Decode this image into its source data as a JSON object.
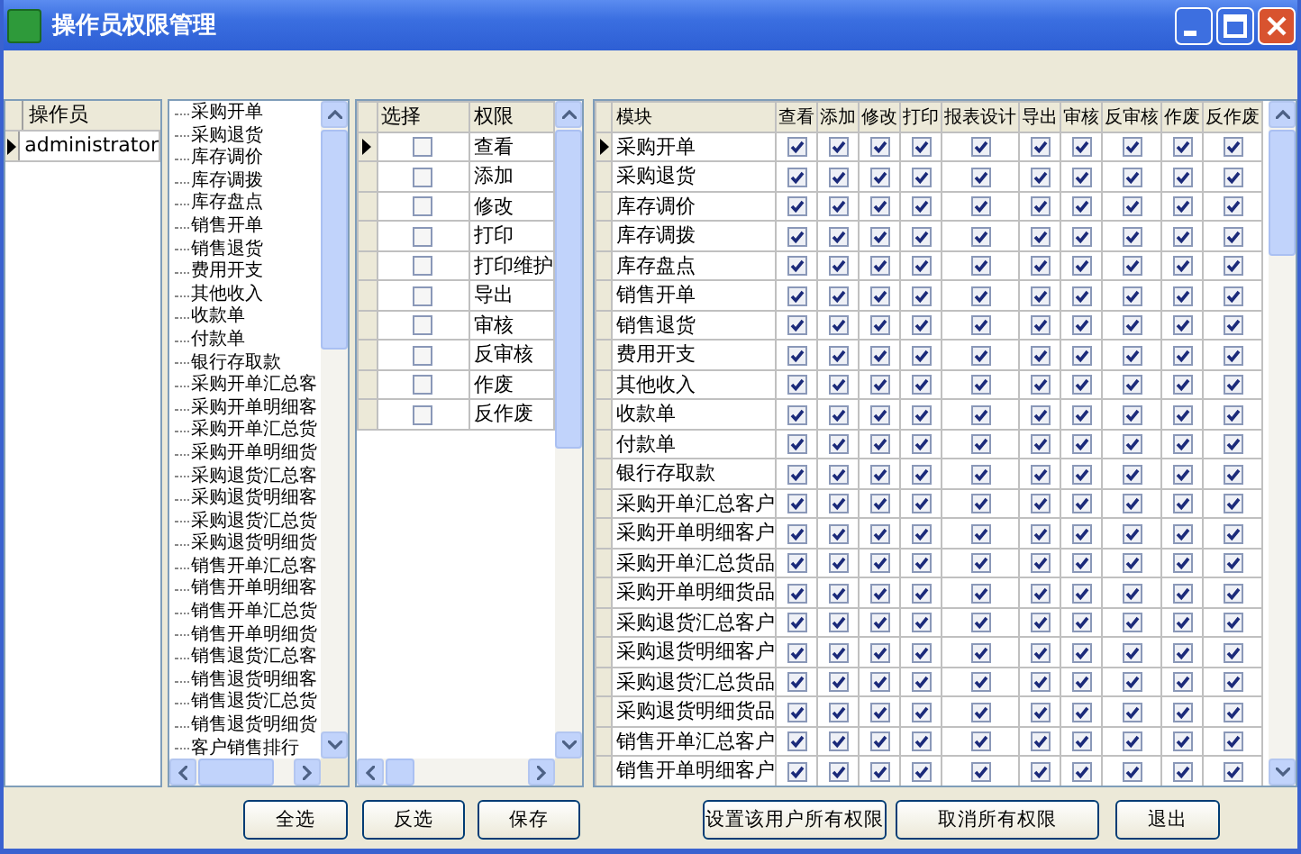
{
  "window": {
    "title": "操作员权限管理"
  },
  "operators": {
    "header": "操作员",
    "rows": [
      {
        "name": "administrator",
        "selected": true
      }
    ]
  },
  "modules_tree": {
    "items": [
      "采购开单",
      "采购退货",
      "库存调价",
      "库存调拨",
      "库存盘点",
      "销售开单",
      "销售退货",
      "费用开支",
      "其他收入",
      "收款单",
      "付款单",
      "银行存取款",
      "采购开单汇总客",
      "采购开单明细客",
      "采购开单汇总货",
      "采购开单明细货",
      "采购退货汇总客",
      "采购退货明细客",
      "采购退货汇总货",
      "采购退货明细货",
      "销售开单汇总客",
      "销售开单明细客",
      "销售开单汇总货",
      "销售开单明细货",
      "销售退货汇总客",
      "销售退货明细客",
      "销售退货汇总货",
      "销售退货明细货",
      "客户销售排行"
    ]
  },
  "rights_grid": {
    "columns": [
      "选择",
      "权限"
    ],
    "rows": [
      {
        "checked": false,
        "name": "查看",
        "selected": true
      },
      {
        "checked": false,
        "name": "添加",
        "selected": false
      },
      {
        "checked": false,
        "name": "修改",
        "selected": false
      },
      {
        "checked": false,
        "name": "打印",
        "selected": false
      },
      {
        "checked": false,
        "name": "打印维护",
        "selected": false
      },
      {
        "checked": false,
        "name": "导出",
        "selected": false
      },
      {
        "checked": false,
        "name": "审核",
        "selected": false
      },
      {
        "checked": false,
        "name": "反审核",
        "selected": false
      },
      {
        "checked": false,
        "name": "作废",
        "selected": false
      },
      {
        "checked": false,
        "name": "反作废",
        "selected": false
      }
    ]
  },
  "permissions_grid": {
    "columns": [
      "模块",
      "查看",
      "添加",
      "修改",
      "打印",
      "报表设计",
      "导出",
      "审核",
      "反审核",
      "作废",
      "反作废"
    ],
    "rows": [
      {
        "module": "采购开单",
        "selected": true,
        "checks": [
          true,
          true,
          true,
          true,
          true,
          true,
          true,
          true,
          true,
          true
        ]
      },
      {
        "module": "采购退货",
        "selected": false,
        "checks": [
          true,
          true,
          true,
          true,
          true,
          true,
          true,
          true,
          true,
          true
        ]
      },
      {
        "module": "库存调价",
        "selected": false,
        "checks": [
          true,
          true,
          true,
          true,
          true,
          true,
          true,
          true,
          true,
          true
        ]
      },
      {
        "module": "库存调拨",
        "selected": false,
        "checks": [
          true,
          true,
          true,
          true,
          true,
          true,
          true,
          true,
          true,
          true
        ]
      },
      {
        "module": "库存盘点",
        "selected": false,
        "checks": [
          true,
          true,
          true,
          true,
          true,
          true,
          true,
          true,
          true,
          true
        ]
      },
      {
        "module": "销售开单",
        "selected": false,
        "checks": [
          true,
          true,
          true,
          true,
          true,
          true,
          true,
          true,
          true,
          true
        ]
      },
      {
        "module": "销售退货",
        "selected": false,
        "checks": [
          true,
          true,
          true,
          true,
          true,
          true,
          true,
          true,
          true,
          true
        ]
      },
      {
        "module": "费用开支",
        "selected": false,
        "checks": [
          true,
          true,
          true,
          true,
          true,
          true,
          true,
          true,
          true,
          true
        ]
      },
      {
        "module": "其他收入",
        "selected": false,
        "checks": [
          true,
          true,
          true,
          true,
          true,
          true,
          true,
          true,
          true,
          true
        ]
      },
      {
        "module": "收款单",
        "selected": false,
        "checks": [
          true,
          true,
          true,
          true,
          true,
          true,
          true,
          true,
          true,
          true
        ]
      },
      {
        "module": "付款单",
        "selected": false,
        "checks": [
          true,
          true,
          true,
          true,
          true,
          true,
          true,
          true,
          true,
          true
        ]
      },
      {
        "module": "银行存取款",
        "selected": false,
        "checks": [
          true,
          true,
          true,
          true,
          true,
          true,
          true,
          true,
          true,
          true
        ]
      },
      {
        "module": "采购开单汇总客户",
        "selected": false,
        "checks": [
          true,
          true,
          true,
          true,
          true,
          true,
          true,
          true,
          true,
          true
        ]
      },
      {
        "module": "采购开单明细客户",
        "selected": false,
        "checks": [
          true,
          true,
          true,
          true,
          true,
          true,
          true,
          true,
          true,
          true
        ]
      },
      {
        "module": "采购开单汇总货品",
        "selected": false,
        "checks": [
          true,
          true,
          true,
          true,
          true,
          true,
          true,
          true,
          true,
          true
        ]
      },
      {
        "module": "采购开单明细货品",
        "selected": false,
        "checks": [
          true,
          true,
          true,
          true,
          true,
          true,
          true,
          true,
          true,
          true
        ]
      },
      {
        "module": "采购退货汇总客户",
        "selected": false,
        "checks": [
          true,
          true,
          true,
          true,
          true,
          true,
          true,
          true,
          true,
          true
        ]
      },
      {
        "module": "采购退货明细客户",
        "selected": false,
        "checks": [
          true,
          true,
          true,
          true,
          true,
          true,
          true,
          true,
          true,
          true
        ]
      },
      {
        "module": "采购退货汇总货品",
        "selected": false,
        "checks": [
          true,
          true,
          true,
          true,
          true,
          true,
          true,
          true,
          true,
          true
        ]
      },
      {
        "module": "采购退货明细货品",
        "selected": false,
        "checks": [
          true,
          true,
          true,
          true,
          true,
          true,
          true,
          true,
          true,
          true
        ]
      },
      {
        "module": "销售开单汇总客户",
        "selected": false,
        "checks": [
          true,
          true,
          true,
          true,
          true,
          true,
          true,
          true,
          true,
          true
        ]
      },
      {
        "module": "销售开单明细客户",
        "selected": false,
        "checks": [
          true,
          true,
          true,
          true,
          true,
          true,
          true,
          true,
          true,
          true
        ]
      }
    ]
  },
  "buttons": [
    "全选",
    "反选",
    "保存",
    "设置该用户所有权限",
    "取消所有权限",
    "退出"
  ]
}
